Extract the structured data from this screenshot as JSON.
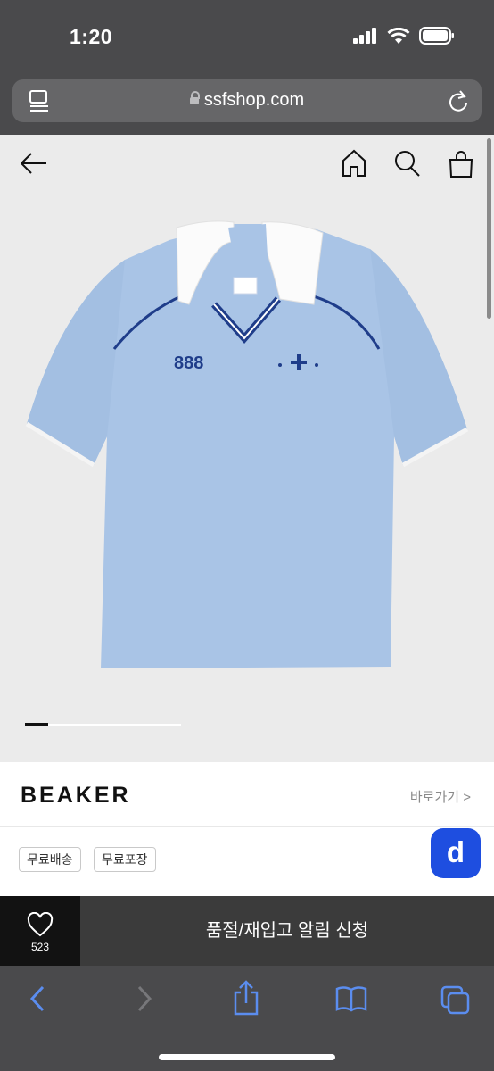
{
  "status_bar": {
    "time": "1:20"
  },
  "browser": {
    "url": "ssfshop.com"
  },
  "product": {
    "image_alt": "light blue polo jersey with white collar",
    "print_text": "888",
    "label_text": "888",
    "carousel": {
      "current": 1,
      "total": 7
    }
  },
  "brand": {
    "name": "BEAKER",
    "link": "바로가기 >"
  },
  "tags": [
    "무료배송",
    "무료포장"
  ],
  "fab": {
    "label": "d"
  },
  "cta": {
    "like_count": "523",
    "notify_label": "품절/재입고 알림 신청"
  },
  "colors": {
    "accent": "#1e4ee0",
    "shirt": "#a9c4e6",
    "navy": "#1f3d8a"
  }
}
